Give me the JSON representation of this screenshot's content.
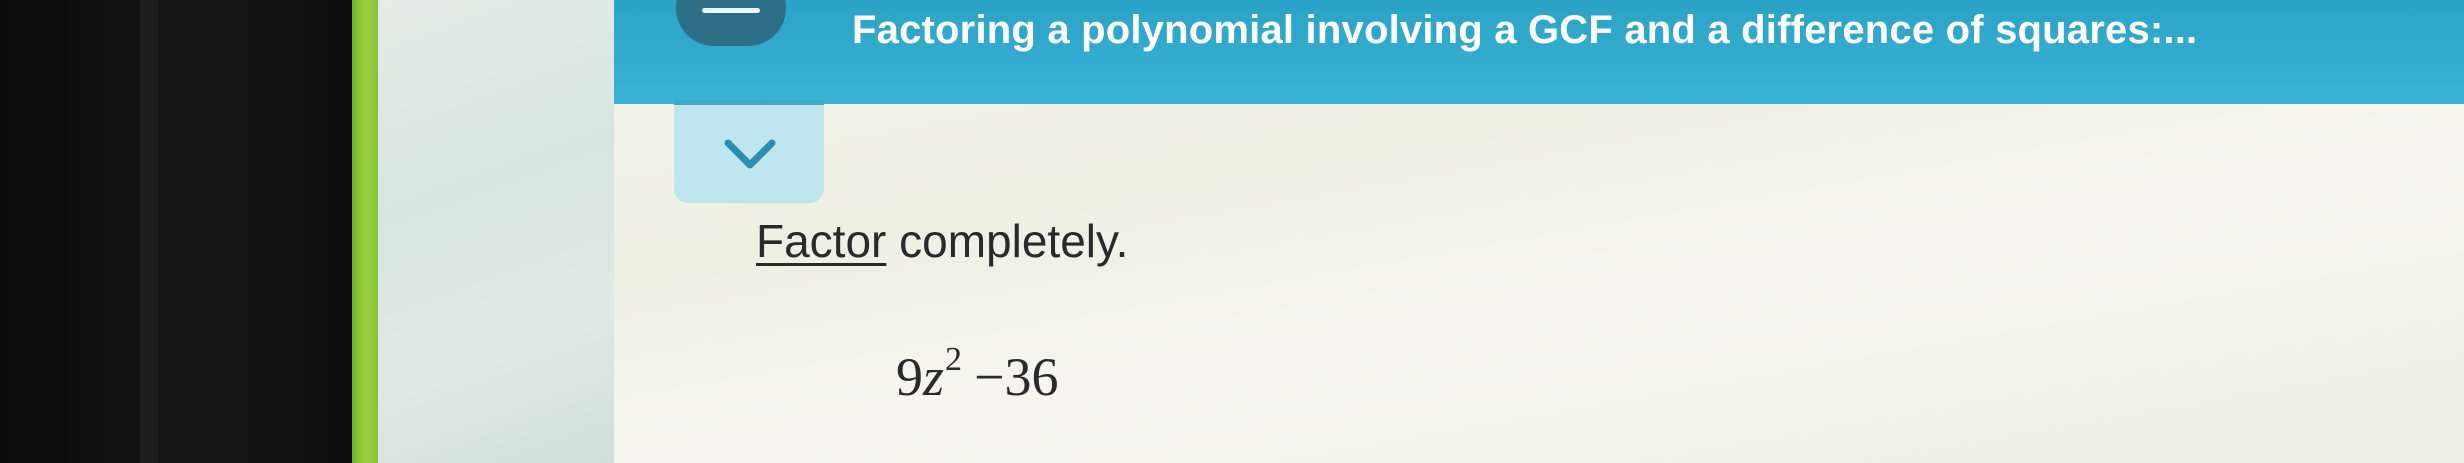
{
  "header": {
    "title": "Factoring a polynomial involving a GCF and a difference of squares:..."
  },
  "problem": {
    "instruction_link": "Factor",
    "instruction_rest": " completely.",
    "expression": {
      "coefficient": "9",
      "variable": "z",
      "exponent": "2",
      "operator": "−",
      "constant": "36"
    }
  },
  "colors": {
    "header_bar": "#3ab2d4",
    "header_tab": "#2d6f86",
    "collapse_tab": "#bfe6ee",
    "chevron": "#2a8fb4",
    "green_edge": "#9bd43e",
    "text": "#2a2a2a"
  },
  "icons": {
    "collapse": "chevron-down-icon",
    "menu": "menu-line-icon"
  }
}
